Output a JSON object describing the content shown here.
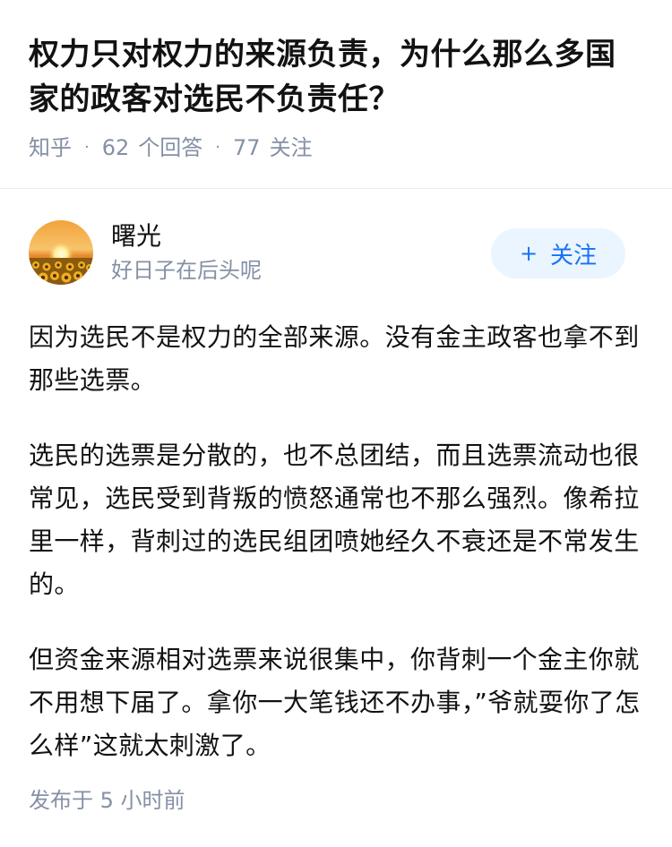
{
  "question": {
    "title": "权力只对权力的来源负责，为什么那么多国家的政客对选民不负责任？",
    "source": "知乎",
    "answer_count": "62",
    "answer_label": "个回答",
    "follow_count": "77",
    "follow_label": "关注"
  },
  "author": {
    "name": "曙光",
    "bio": "好日子在后头呢",
    "follow_button_label": "关注",
    "follow_button_icon": "+"
  },
  "answer": {
    "paragraphs": [
      "因为选民不是权力的全部来源。没有金主政客也拿不到那些选票。",
      "选民的选票是分散的，也不总团结，而且选票流动也很常见，选民受到背叛的愤怒通常也不那么强烈。像希拉里一样，背刺过的选民组团喷她经久不衰还是不常发生的。",
      "但资金来源相对选票来说很集中，你背刺一个金主你就不用想下届了。拿你一大笔钱还不办事，”爷就耍你了怎么样”这就太刺激了。"
    ],
    "published": "发布于  5 小时前"
  },
  "colors": {
    "accent": "#1772f6",
    "meta_gray": "#8590a6",
    "follow_bg": "#ebf5ff"
  }
}
